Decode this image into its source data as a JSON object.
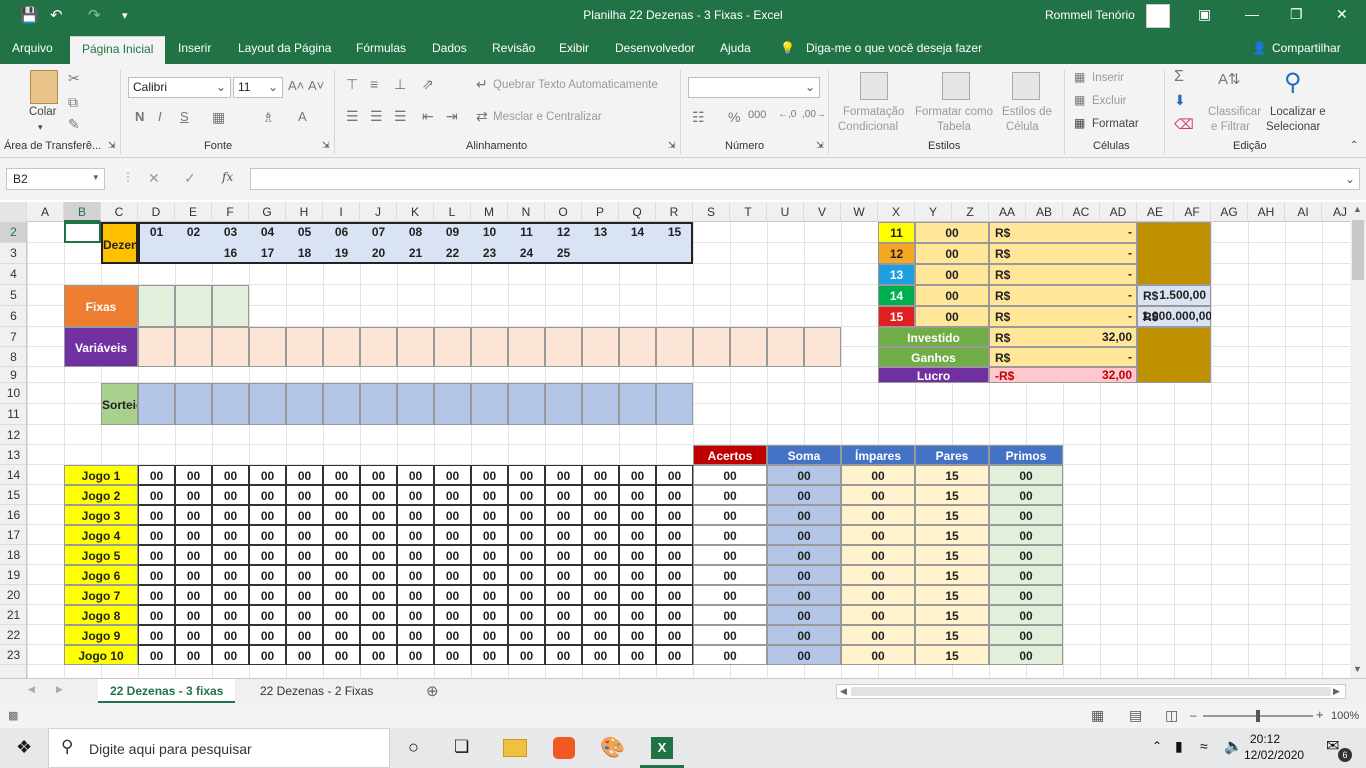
{
  "window": {
    "title": "Planilha 22 Dezenas - 3 Fixas  -  Excel",
    "user": "Rommell Tenório"
  },
  "ribbon_tabs": [
    "Arquivo",
    "Página Inicial",
    "Inserir",
    "Layout da Página",
    "Fórmulas",
    "Dados",
    "Revisão",
    "Exibir",
    "Desenvolvedor",
    "Ajuda"
  ],
  "tell_me": "Diga-me o que você deseja fazer",
  "share": "Compartilhar",
  "ribbon": {
    "colar": "Colar",
    "font_name": "Calibri",
    "font_size": "11",
    "quebrar": "Quebrar Texto Automaticamente",
    "mesclar": "Mesclar e Centralizar",
    "fmt_cond_1": "Formatação",
    "fmt_cond_2": "Condicional",
    "fmt_tab_1": "Formatar como",
    "fmt_tab_2": "Tabela",
    "estilos_1": "Estilos de",
    "estilos_2": "Célula",
    "inserir": "Inserir",
    "excluir": "Excluir",
    "formatar": "Formatar",
    "classificar_1": "Classificar",
    "classificar_2": "e Filtrar",
    "localizar_1": "Localizar e",
    "localizar_2": "Selecionar",
    "groups": [
      "Área de Transferê...",
      "Fonte",
      "Alinhamento",
      "Número",
      "Estilos",
      "Células",
      "Edição"
    ]
  },
  "formula_bar": {
    "name_box": "B2",
    "fx": "fx",
    "content": ""
  },
  "columns": [
    "A",
    "B",
    "C",
    "D",
    "E",
    "F",
    "G",
    "H",
    "I",
    "J",
    "K",
    "L",
    "M",
    "N",
    "O",
    "P",
    "Q",
    "R",
    "S",
    "T",
    "U",
    "V",
    "W",
    "X",
    "Y",
    "Z",
    "AA",
    "AB",
    "AC",
    "AD",
    "AE",
    "AF",
    "AG",
    "AH",
    "AI",
    "AJ"
  ],
  "rows": [
    "2",
    "3",
    "4",
    "5",
    "6",
    "7",
    "8",
    "9",
    "10",
    "11",
    "12",
    "13",
    "14",
    "15",
    "16",
    "17",
    "18",
    "19",
    "20",
    "21",
    "22",
    "23"
  ],
  "sheet": {
    "dezenas_label": "Dezenas",
    "dezenas_row1": [
      "01",
      "02",
      "03",
      "04",
      "05",
      "06",
      "07",
      "08",
      "09",
      "10",
      "11",
      "12",
      "13",
      "14",
      "15"
    ],
    "dezenas_row2": [
      "16",
      "17",
      "18",
      "19",
      "20",
      "21",
      "22",
      "23",
      "24",
      "25"
    ],
    "fixas_label": "Fixas",
    "variaveis_label": "Variáveis",
    "sorteio_label": "Sorteio",
    "prizes": [
      {
        "hits": "11",
        "qty": "00",
        "cur": "R$",
        "val": "-",
        "color": "#ffff00"
      },
      {
        "hits": "12",
        "qty": "00",
        "cur": "R$",
        "val": "-",
        "color": "#f5a623"
      },
      {
        "hits": "13",
        "qty": "00",
        "cur": "R$",
        "val": "-",
        "color": "#1f9fe0"
      },
      {
        "hits": "14",
        "qty": "00",
        "cur": "R$",
        "val": "-",
        "color": "#00b050"
      },
      {
        "hits": "15",
        "qty": "00",
        "cur": "R$",
        "val": "-",
        "color": "#e02020"
      }
    ],
    "prize14_cur": "R$",
    "prize14_val": "1.500,00",
    "prize15_cur": "R$",
    "prize15_val": "1.000.000,00",
    "investido_label": "Investido",
    "investido_cur": "R$",
    "investido_val": "32,00",
    "ganhos_label": "Ganhos",
    "ganhos_cur": "R$",
    "ganhos_val": "-",
    "lucro_label": "Lucro",
    "lucro_cur": "-R$",
    "lucro_val": "32,00",
    "headers": [
      "Acertos",
      "Soma",
      "Ímpares",
      "Pares",
      "Primos"
    ],
    "jogos": [
      {
        "label": "Jogo 1",
        "acertos": "00",
        "soma": "00",
        "impares": "00",
        "pares": "15",
        "primos": "00"
      },
      {
        "label": "Jogo 2",
        "acertos": "00",
        "soma": "00",
        "impares": "00",
        "pares": "15",
        "primos": "00"
      },
      {
        "label": "Jogo 3",
        "acertos": "00",
        "soma": "00",
        "impares": "00",
        "pares": "15",
        "primos": "00"
      },
      {
        "label": "Jogo 4",
        "acertos": "00",
        "soma": "00",
        "impares": "00",
        "pares": "15",
        "primos": "00"
      },
      {
        "label": "Jogo 5",
        "acertos": "00",
        "soma": "00",
        "impares": "00",
        "pares": "15",
        "primos": "00"
      },
      {
        "label": "Jogo 6",
        "acertos": "00",
        "soma": "00",
        "impares": "00",
        "pares": "15",
        "primos": "00"
      },
      {
        "label": "Jogo 7",
        "acertos": "00",
        "soma": "00",
        "impares": "00",
        "pares": "15",
        "primos": "00"
      },
      {
        "label": "Jogo 8",
        "acertos": "00",
        "soma": "00",
        "impares": "00",
        "pares": "15",
        "primos": "00"
      },
      {
        "label": "Jogo 9",
        "acertos": "00",
        "soma": "00",
        "impares": "00",
        "pares": "15",
        "primos": "00"
      },
      {
        "label": "Jogo 10",
        "acertos": "00",
        "soma": "00",
        "impares": "00",
        "pares": "15",
        "primos": "00"
      }
    ],
    "jogo_numbers": "00"
  },
  "sheet_tabs": [
    "22 Dezenas - 3 fixas",
    "22 Dezenas - 2 Fixas"
  ],
  "status": {
    "zoom": "100%"
  },
  "taskbar": {
    "search": "Digite aqui para pesquisar",
    "time": "20:12",
    "date": "12/02/2020",
    "notif": "6"
  }
}
